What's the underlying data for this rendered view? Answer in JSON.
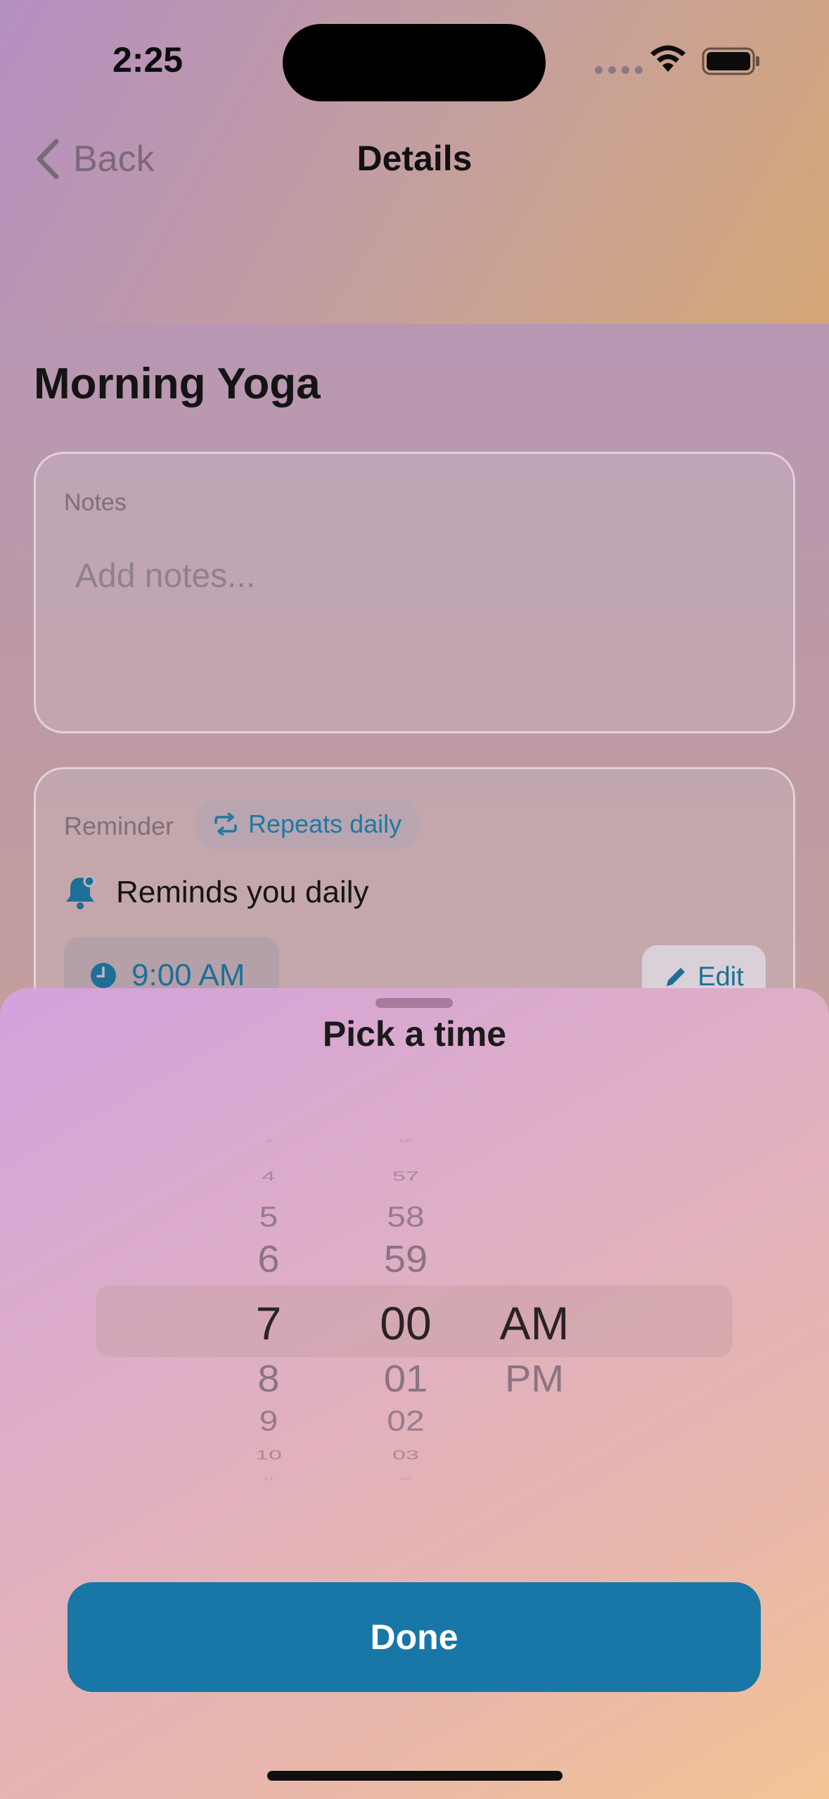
{
  "status_bar": {
    "time": "2:25"
  },
  "nav": {
    "back_label": "Back",
    "title": "Details"
  },
  "task": {
    "title": "Morning Yoga"
  },
  "notes": {
    "label": "Notes",
    "placeholder": "Add notes..."
  },
  "reminder": {
    "label": "Reminder",
    "repeat_chip": "Repeats daily",
    "description": "Reminds you daily",
    "time": "9:00 AM",
    "edit_label": "Edit"
  },
  "sheet": {
    "title": "Pick a time",
    "hours": [
      "3",
      "4",
      "5",
      "6",
      "7",
      "8",
      "9",
      "10",
      "11"
    ],
    "minutes": [
      "56",
      "57",
      "58",
      "59",
      "00",
      "01",
      "02",
      "03",
      "04"
    ],
    "periods": [
      "AM",
      "PM"
    ],
    "selected": {
      "hour": "7",
      "minute": "00",
      "period": "AM"
    },
    "done_label": "Done"
  },
  "colors": {
    "accent": "#1877a6",
    "accent_text": "#1e6f98"
  },
  "icons": [
    "chevron-left-icon",
    "wifi-icon",
    "battery-icon",
    "repeat-icon",
    "bell-icon",
    "clock-icon",
    "pencil-icon"
  ]
}
